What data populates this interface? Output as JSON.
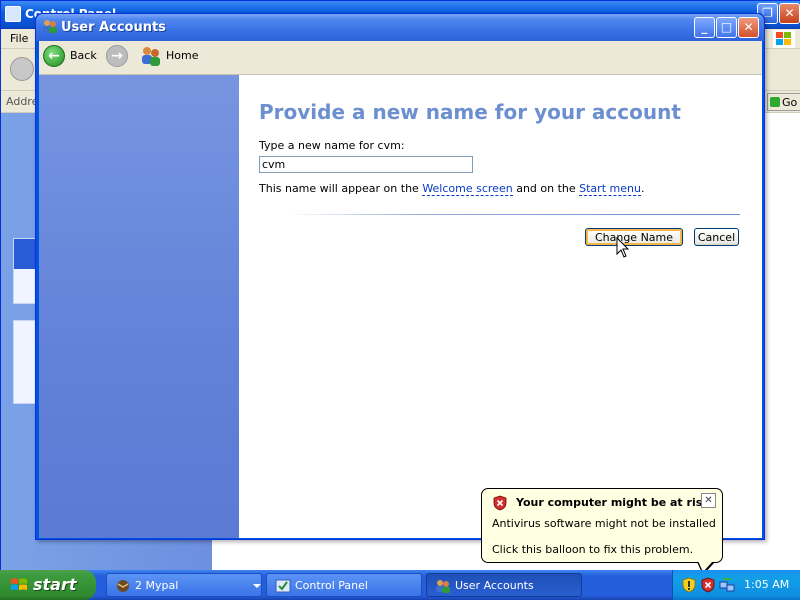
{
  "background_window": {
    "title": "Control Panel",
    "menu": {
      "file": "File"
    },
    "address_label": "Address",
    "go_label": "Go"
  },
  "window": {
    "title": "User Accounts",
    "icon": "user-accounts-icon",
    "controls": [
      "minimize",
      "maximize",
      "close"
    ]
  },
  "navbar": {
    "back_label": "Back",
    "home_label": "Home"
  },
  "content": {
    "heading": "Provide a new name for your account",
    "prompt": "Type a new name for cvm:",
    "name_value": "cvm",
    "note_prefix": "This name will appear on the ",
    "note_link1": "Welcome screen",
    "note_middle": " and on the ",
    "note_link2": "Start menu",
    "note_suffix": ".",
    "change_button": "Change Name",
    "cancel_button": "Cancel"
  },
  "balloon": {
    "title": "Your computer might be at risk",
    "line1": "Antivirus software might not be installed",
    "line2": "Click this balloon to fix this problem."
  },
  "taskbar": {
    "start_label": "start",
    "tasks": [
      {
        "label": "2 Mypal",
        "icon": "mypal-icon"
      },
      {
        "label": "Control Panel",
        "icon": "control-panel-icon"
      },
      {
        "label": "User Accounts",
        "icon": "user-accounts-icon",
        "active": true
      }
    ],
    "clock": "1:05 AM"
  },
  "colors": {
    "heading": "#6b8fd0",
    "link": "#0a3cc4",
    "balloon_bg": "#ffffe1",
    "taskbar_blue": "#245edb",
    "start_green": "#3c9a3c"
  }
}
